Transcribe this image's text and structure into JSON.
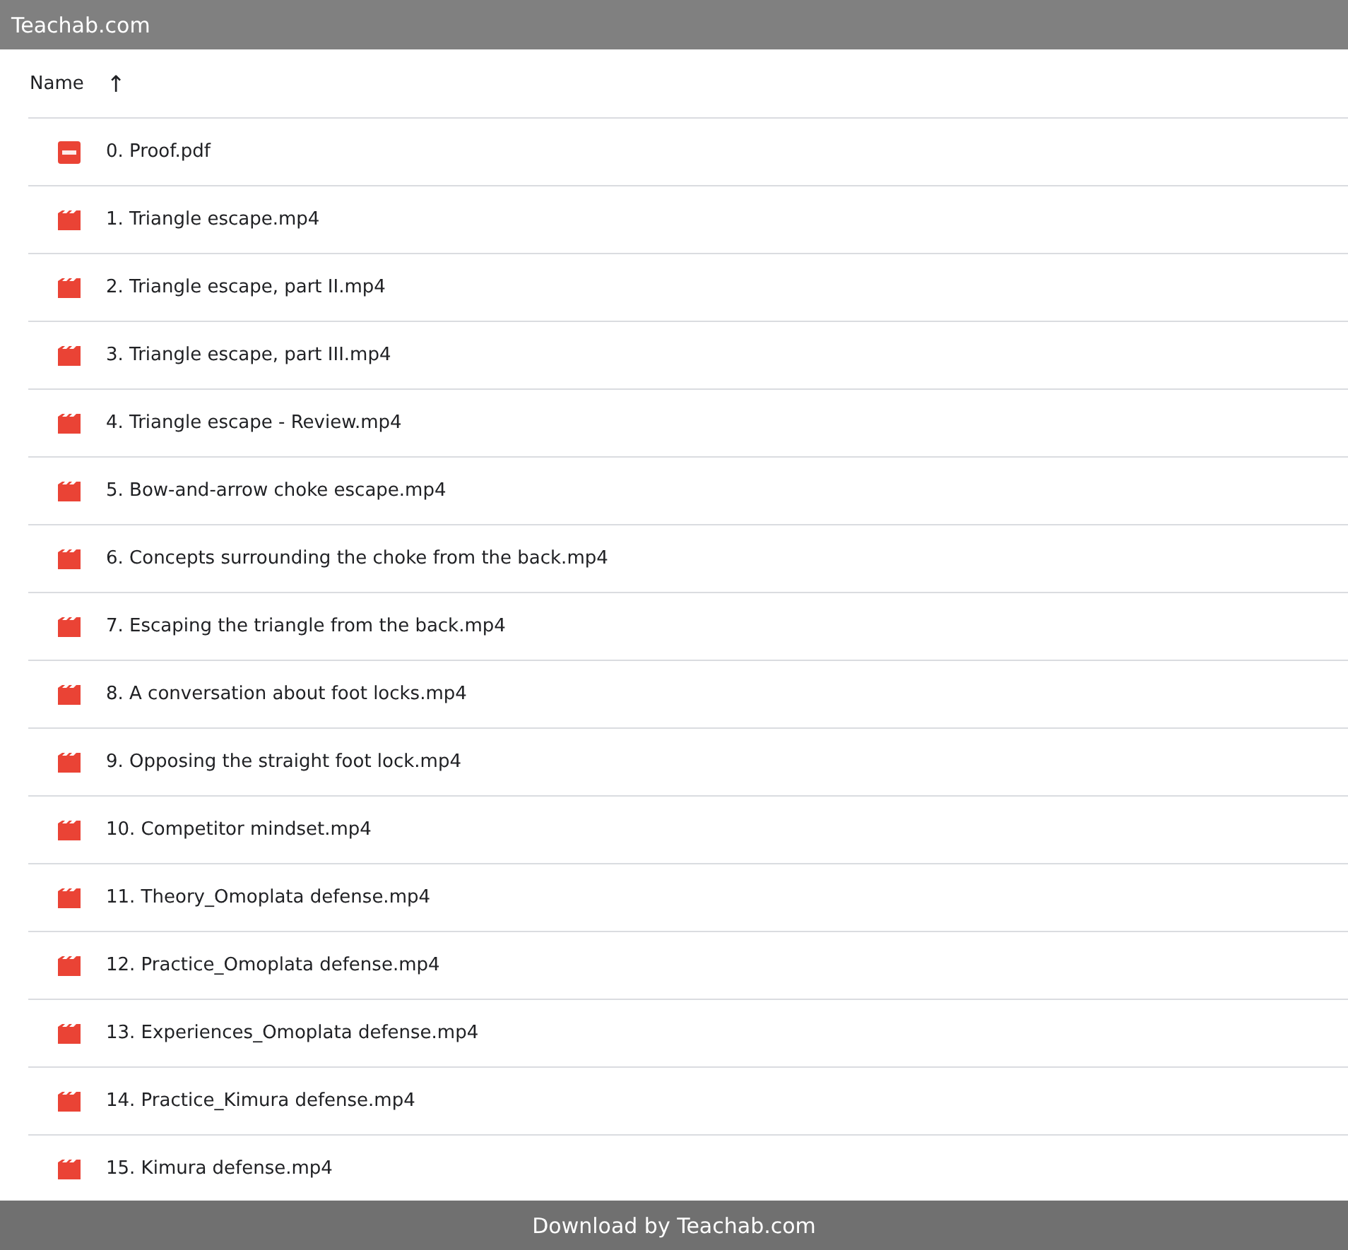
{
  "header": {
    "title": "Teachab.com"
  },
  "list": {
    "column": "Name",
    "sort_icon": "↑",
    "files": [
      {
        "kind": "pdf",
        "name": "0. Proof.pdf"
      },
      {
        "kind": "video",
        "name": "1. Triangle escape.mp4"
      },
      {
        "kind": "video",
        "name": "2. Triangle escape, part II.mp4"
      },
      {
        "kind": "video",
        "name": "3. Triangle escape, part III.mp4"
      },
      {
        "kind": "video",
        "name": "4. Triangle escape - Review.mp4"
      },
      {
        "kind": "video",
        "name": "5. Bow-and-arrow choke escape.mp4"
      },
      {
        "kind": "video",
        "name": "6. Concepts surrounding the choke from the back.mp4"
      },
      {
        "kind": "video",
        "name": "7. Escaping the triangle from the back.mp4"
      },
      {
        "kind": "video",
        "name": "8. A conversation about foot locks.mp4"
      },
      {
        "kind": "video",
        "name": "9. Opposing the straight foot lock.mp4"
      },
      {
        "kind": "video",
        "name": "10. Competitor mindset.mp4"
      },
      {
        "kind": "video",
        "name": "11. Theory_Omoplata defense.mp4"
      },
      {
        "kind": "video",
        "name": "12. Practice_Omoplata defense.mp4"
      },
      {
        "kind": "video",
        "name": "13. Experiences_Omoplata defense.mp4"
      },
      {
        "kind": "video",
        "name": "14. Practice_Kimura defense.mp4"
      },
      {
        "kind": "video",
        "name": "15. Kimura defense.mp4"
      }
    ]
  },
  "footer": {
    "text": "Download by Teachab.com"
  }
}
